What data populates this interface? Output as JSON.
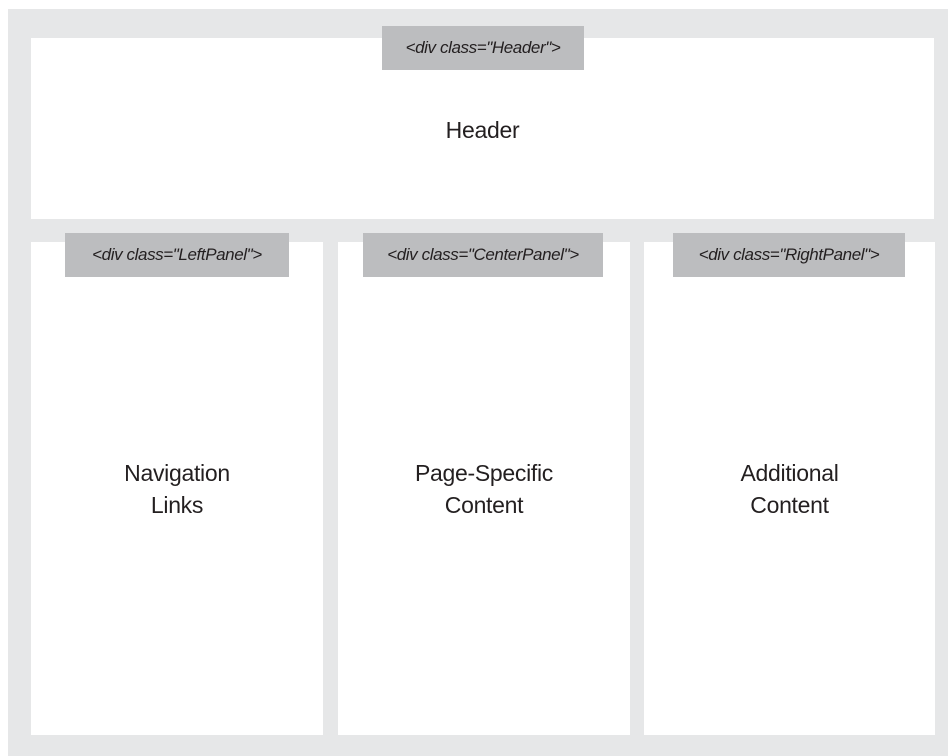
{
  "header": {
    "tag": "<div class=\"Header\">",
    "label": "Header"
  },
  "left_panel": {
    "tag": "<div class=\"LeftPanel\">",
    "label_lines": [
      "Navigation",
      "Links"
    ]
  },
  "center_panel": {
    "tag": "<div class=\"CenterPanel\">",
    "label_lines": [
      "Page-Specific",
      "Content"
    ]
  },
  "right_panel": {
    "tag": "<div class=\"RightPanel\">",
    "label_lines": [
      "Additional",
      "Content"
    ]
  },
  "colors": {
    "frame_background": "#e6e7e8",
    "box_background": "#ffffff",
    "tag_background": "#bcbdbf",
    "text": "#231f20"
  }
}
